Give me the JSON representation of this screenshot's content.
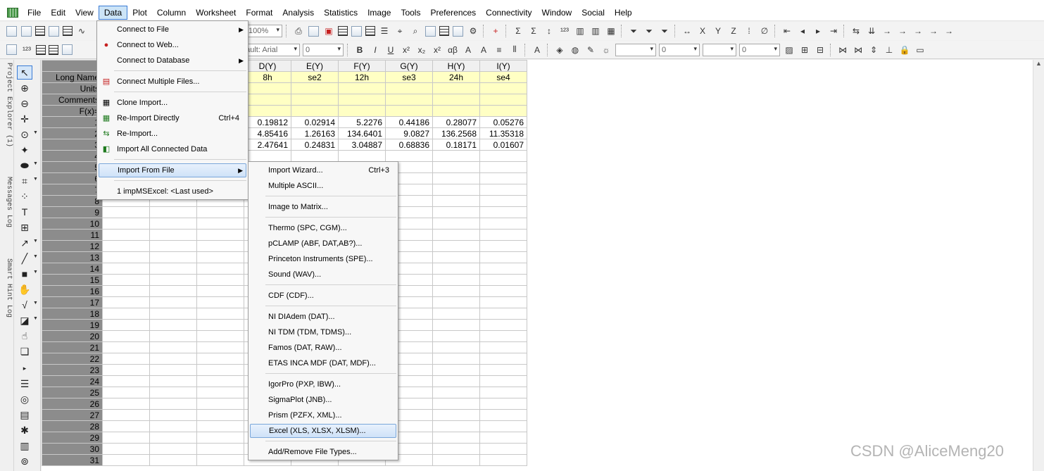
{
  "menubar": {
    "items": [
      "File",
      "Edit",
      "View",
      "Data",
      "Plot",
      "Column",
      "Worksheet",
      "Format",
      "Analysis",
      "Statistics",
      "Image",
      "Tools",
      "Preferences",
      "Connectivity",
      "Window",
      "Social",
      "Help"
    ],
    "active": "Data"
  },
  "toolbar": {
    "zoom": "100%",
    "font": "Default: Arial",
    "font_size": "0",
    "line_width": "0",
    "line_width2": "0"
  },
  "dock_tabs": [
    "Project Explorer (1)",
    "Messages Log",
    "Smart Hint Log"
  ],
  "worksheet": {
    "col_headers": [
      "D(Y)",
      "E(Y)",
      "F(Y)",
      "G(Y)",
      "H(Y)",
      "I(Y)"
    ],
    "row_labels": [
      "Long Name",
      "Units",
      "Comments",
      "F(x)="
    ],
    "long_names": [
      "8h",
      "se2",
      "12h",
      "se3",
      "24h",
      "se4"
    ],
    "rows": [
      [
        "0.19812",
        "0.02914",
        "5.2276",
        "0.44186",
        "0.28077",
        "0.05276"
      ],
      [
        "4.85416",
        "1.26163",
        "134.6401",
        "9.0827",
        "136.2568",
        "11.35318"
      ],
      [
        "2.47641",
        "0.24831",
        "3.04887",
        "0.68836",
        "0.18171",
        "0.01607"
      ]
    ],
    "row_numbers": [
      "1",
      "2",
      "3",
      "4",
      "5",
      "6",
      "7",
      "8",
      "9",
      "10",
      "11",
      "12",
      "13",
      "14",
      "15",
      "16",
      "17",
      "18",
      "19",
      "20",
      "21",
      "22",
      "23",
      "24",
      "25",
      "26",
      "27",
      "28",
      "29",
      "30",
      "31"
    ]
  },
  "data_menu": {
    "items": [
      {
        "label": "Connect to File",
        "shortcut": "",
        "submenu": true
      },
      {
        "label": "Connect to Web...",
        "shortcut": "",
        "submenu": false
      },
      {
        "label": "Connect to Database",
        "shortcut": "",
        "submenu": true
      },
      {
        "label": "Connect Multiple Files...",
        "shortcut": "",
        "submenu": false
      },
      {
        "label": "Clone Import...",
        "shortcut": "",
        "submenu": false
      },
      {
        "label": "Re-Import Directly",
        "shortcut": "Ctrl+4",
        "submenu": false
      },
      {
        "label": "Re-Import...",
        "shortcut": "",
        "submenu": false
      },
      {
        "label": "Import All Connected Data",
        "shortcut": "",
        "submenu": false
      },
      {
        "label": "Import From File",
        "shortcut": "",
        "submenu": true
      },
      {
        "label": "1 impMSExcel: <Last used>",
        "shortcut": "",
        "submenu": false
      }
    ]
  },
  "import_submenu": {
    "items": [
      {
        "label": "Import Wizard...",
        "shortcut": "Ctrl+3"
      },
      {
        "label": "Multiple ASCII...",
        "shortcut": ""
      },
      {
        "label": "Image to Matrix...",
        "shortcut": ""
      },
      {
        "label": "Thermo (SPC, CGM)...",
        "shortcut": ""
      },
      {
        "label": "pCLAMP (ABF, DAT,AB?)...",
        "shortcut": ""
      },
      {
        "label": "Princeton Instruments (SPE)...",
        "shortcut": ""
      },
      {
        "label": "Sound (WAV)...",
        "shortcut": ""
      },
      {
        "label": "CDF (CDF)...",
        "shortcut": ""
      },
      {
        "label": "NI DIAdem (DAT)...",
        "shortcut": ""
      },
      {
        "label": "NI TDM (TDM, TDMS)...",
        "shortcut": ""
      },
      {
        "label": "Famos (DAT, RAW)...",
        "shortcut": ""
      },
      {
        "label": "ETAS INCA MDF (DAT, MDF)...",
        "shortcut": ""
      },
      {
        "label": "IgorPro (PXP, IBW)...",
        "shortcut": ""
      },
      {
        "label": "SigmaPlot (JNB)...",
        "shortcut": ""
      },
      {
        "label": "Prism (PZFX, XML)...",
        "shortcut": ""
      },
      {
        "label": "Excel (XLS, XLSX, XLSM)...",
        "shortcut": ""
      },
      {
        "label": "Add/Remove File Types...",
        "shortcut": ""
      }
    ]
  },
  "watermark": "CSDN @AliceMeng20"
}
